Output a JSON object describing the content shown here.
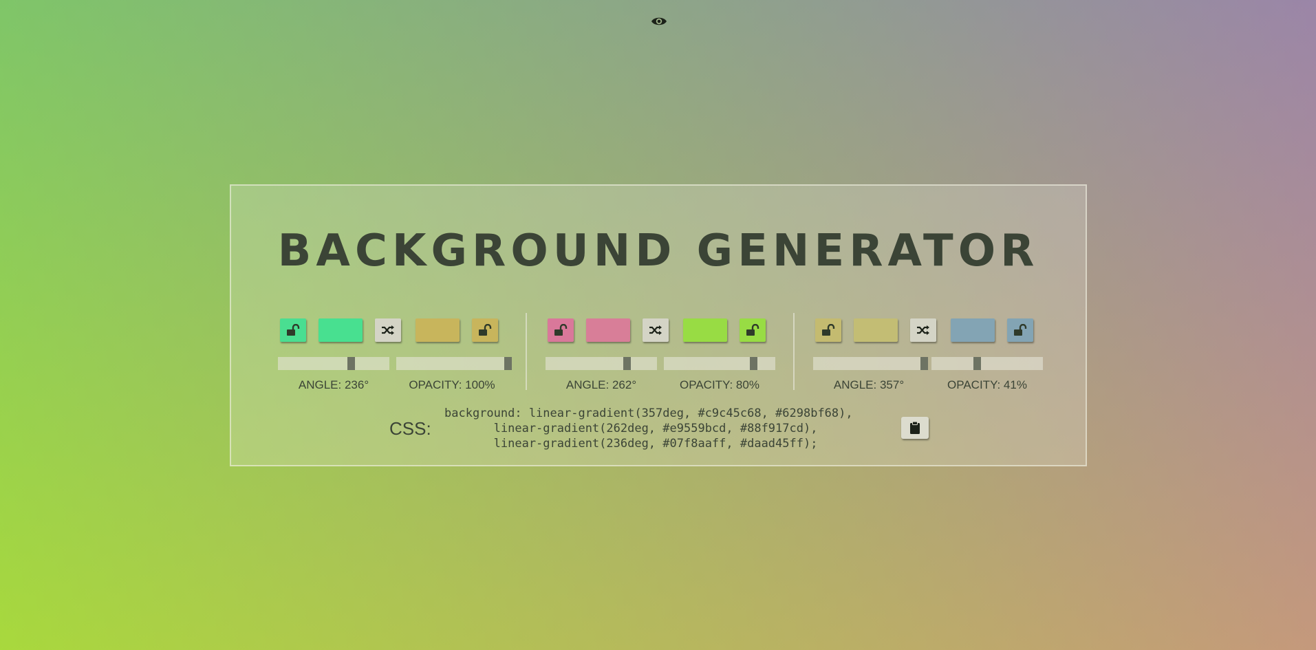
{
  "toggle_icon": "eye-icon",
  "title": "BACKGROUND GENERATOR",
  "layers": [
    {
      "lock_left": {
        "color": "#4ade91",
        "icon": "unlock-icon"
      },
      "color_left": "#48e090",
      "shuffle_icon": "shuffle-icon",
      "color_right": "#c8b55c",
      "lock_right": {
        "color": "#c8b55c",
        "icon": "unlock-icon"
      },
      "angle": 236,
      "opacity": 100,
      "angle_label": "ANGLE: 236°",
      "opacity_label": "OPACITY: 100%"
    },
    {
      "lock_left": {
        "color": "#d9789a",
        "icon": "unlock-icon"
      },
      "color_left": "#d87e98",
      "shuffle_icon": "shuffle-icon",
      "color_right": "#98dc44",
      "lock_right": {
        "color": "#98dc44",
        "icon": "unlock-icon"
      },
      "angle": 262,
      "opacity": 80,
      "angle_label": "ANGLE: 262°",
      "opacity_label": "OPACITY: 80%"
    },
    {
      "lock_left": {
        "color": "#c4bb70",
        "icon": "unlock-icon"
      },
      "color_left": "#c3bd74",
      "shuffle_icon": "shuffle-icon",
      "color_right": "#83a4b4",
      "lock_right": {
        "color": "#83a4b4",
        "icon": "unlock-icon"
      },
      "angle": 357,
      "opacity": 41,
      "angle_label": "ANGLE: 357°",
      "opacity_label": "OPACITY: 41%"
    }
  ],
  "css": {
    "label": "CSS:",
    "code": "background: linear-gradient(357deg, #c9c45c68, #6298bf68),\n       linear-gradient(262deg, #e9559bcd, #88f917cd),\n       linear-gradient(236deg, #07f8aaff, #daad45ff);",
    "copy_icon": "clipboard-icon"
  }
}
